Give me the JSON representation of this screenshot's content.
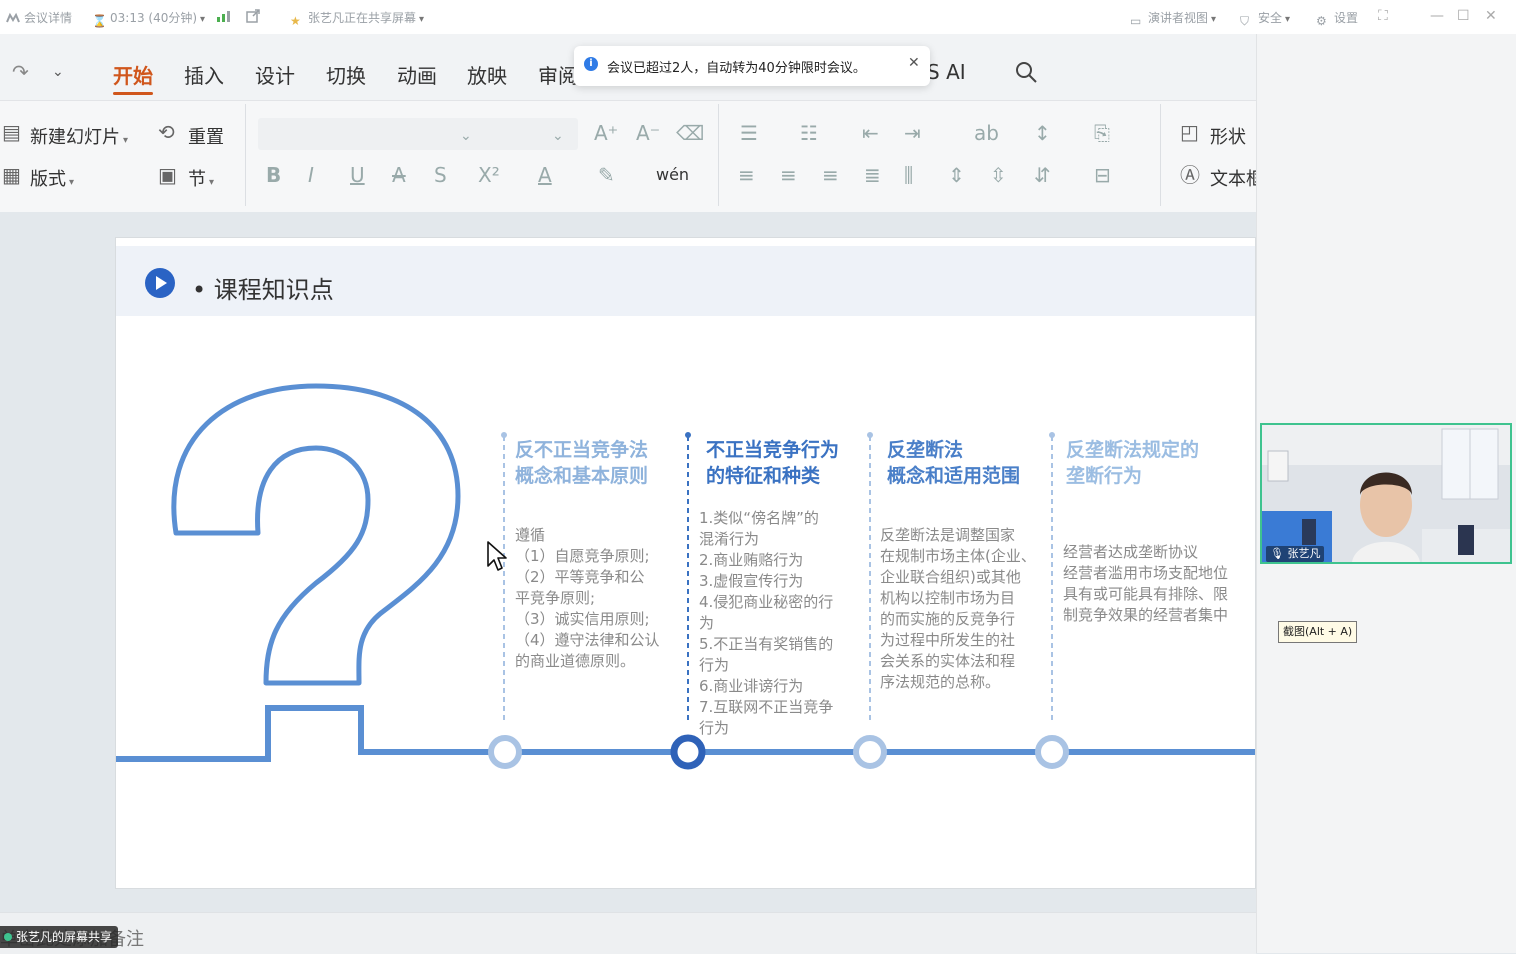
{
  "meeting_bar": {
    "details": "会议详情",
    "timer": "03:13 (40分钟)",
    "sharing": "张艺凡正在共享屏幕",
    "presenter_view": "演讲者视图",
    "security": "安全",
    "settings": "设置"
  },
  "ribbon": {
    "tabs": [
      "开始",
      "插入",
      "设计",
      "切换",
      "动画",
      "放映",
      "审阅"
    ],
    "tab_ai": "PS AI",
    "new_slide": "新建幻灯片",
    "reset": "重置",
    "layout": "版式",
    "section": "节",
    "shape": "形状",
    "textbox": "文本框"
  },
  "notice": {
    "message": "会议已超过2人，自动转为40分钟限时会议。"
  },
  "slide": {
    "title": "课程知识点",
    "columns": [
      {
        "title": [
          "反不正当竞争法",
          "概念和基本原则"
        ],
        "color": "#8fb3dc",
        "body": [
          "遵循",
          "（1）自愿竞争原则;",
          "（2）平等竞争和公",
          "平竞争原则;",
          "（3）诚实信用原则;",
          "（4）遵守法律和公认",
          "的商业道德原则。"
        ]
      },
      {
        "title": [
          "不正当竞争行为",
          "的特征和种类"
        ],
        "color": "#3a72c2",
        "body": [
          "1.类似“傍名牌”的",
          "混淆行为",
          "2.商业贿赂行为",
          "3.虚假宣传行为",
          "4.侵犯商业秘密的行",
          "为",
          "5.不正当有奖销售的",
          "行为",
          "6.商业诽谤行为",
          "7.互联网不正当竞争",
          "行为"
        ]
      },
      {
        "title": [
          "反垄断法",
          "概念和适用范围"
        ],
        "color": "#4a7fc8",
        "body": [
          "反垄断法是调整国家",
          "在规制市场主体(企业、",
          "企业联合组织)或其他",
          "机构以控制市场为目",
          "的而实施的反竞争行",
          "为过程中所发生的社",
          "会关系的实体法和程",
          "序法规范的总称。"
        ]
      },
      {
        "title": [
          "反垄断法规定的",
          "垄断行为"
        ],
        "color": "#9bbde2",
        "body": [
          "经营者达成垄断协议",
          "经营者滥用市场支配地位",
          "具有或可能具有排除、限",
          "制竞争效果的经营者集中"
        ]
      }
    ]
  },
  "participant": {
    "name": "张艺凡"
  },
  "tooltip": "截图(Alt + A)",
  "bottom": {
    "notes_hint": "单击此处添加备注",
    "share_badge": "张艺凡的屏幕共享"
  },
  "colors": {
    "accent": "#d0561c",
    "line_blue": "#5a8fd3",
    "video_border": "#3ec38f"
  }
}
